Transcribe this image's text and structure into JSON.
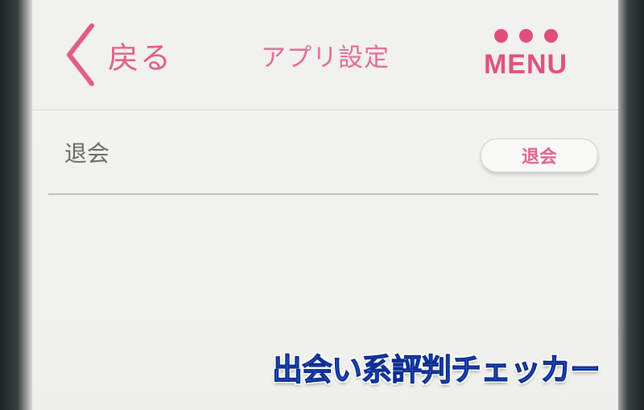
{
  "header": {
    "back_label": "戻る",
    "title": "アプリ設定",
    "menu_label": "MENU"
  },
  "settings": {
    "rows": [
      {
        "label": "退会",
        "button_label": "退会"
      }
    ]
  },
  "watermark": "出会い系評判チェッカー",
  "colors": {
    "accent": "#e0497a",
    "title": "#e0688f",
    "background": "#f3f3f1",
    "watermark": "#2f6fe0"
  },
  "icons": {
    "back": "chevron-left-icon",
    "menu": "three-dots-icon"
  }
}
